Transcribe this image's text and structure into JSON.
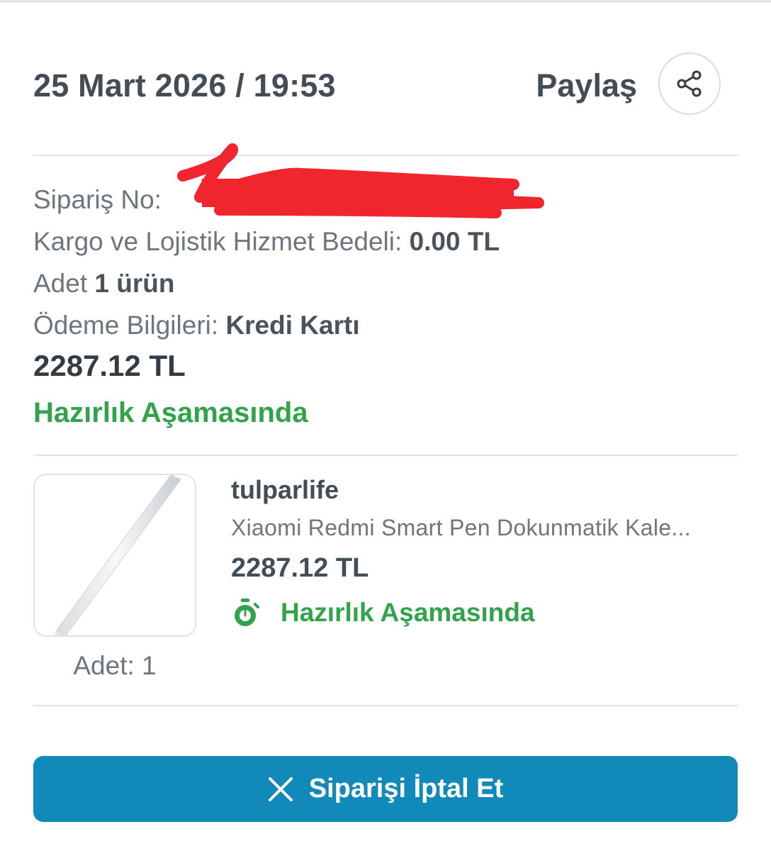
{
  "order": {
    "date_time": "25 Mart 2026 / 19:53",
    "share_label": "Paylaş",
    "order_no_label": "Sipariş No:",
    "shipping_label": "Kargo ve Lojistik Hizmet Bedeli:",
    "shipping_value": "0.00 TL",
    "quantity_label": "Adet",
    "quantity_value": "1 ürün",
    "payment_label": "Ödeme Bilgileri:",
    "payment_value": "Kredi Kartı",
    "total": "2287.12 TL",
    "status": "Hazırlık Aşamasında"
  },
  "product": {
    "seller": "tulparlife",
    "name": "Xiaomi Redmi Smart Pen Dokunmatik Kale...",
    "price": "2287.12 TL",
    "status": "Hazırlık Aşamasında",
    "quantity_label": "Adet: 1"
  },
  "actions": {
    "cancel_label": "Siparişi İptal Et"
  },
  "colors": {
    "status_green": "#30a34b",
    "primary_button": "#1189b9",
    "redaction": "#f0252e"
  },
  "icons": {
    "share": "share-icon",
    "timer": "stopwatch-icon",
    "close": "close-icon"
  }
}
